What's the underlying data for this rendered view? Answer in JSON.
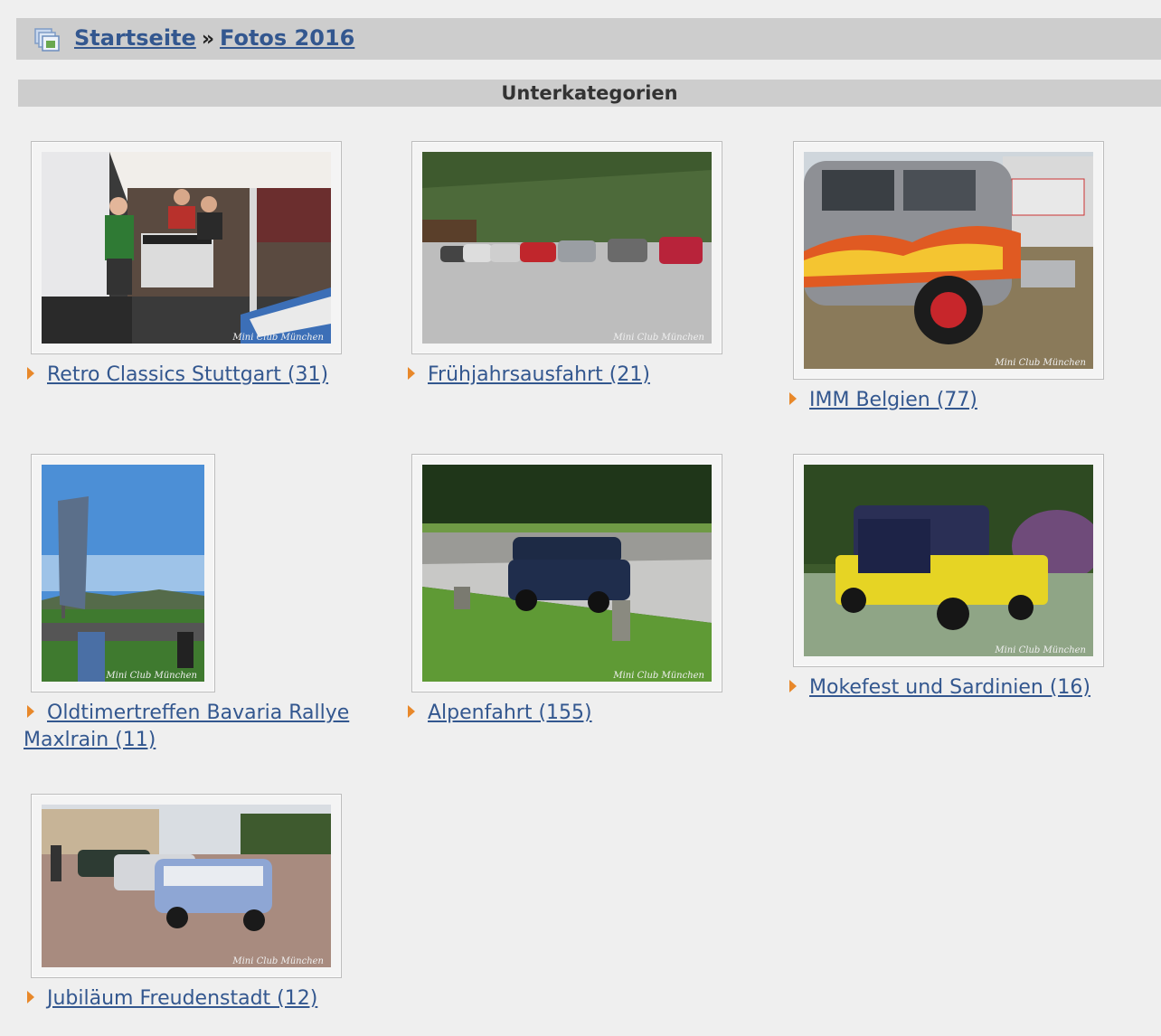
{
  "breadcrumb": {
    "home": "Startseite",
    "separator": "»",
    "current": "Fotos 2016"
  },
  "section": {
    "title": "Unterkategorien"
  },
  "watermark": "Mini Club München",
  "categories": [
    {
      "label": "Retro Classics Stuttgart (31)"
    },
    {
      "label": "Frühjahrsausfahrt (21)"
    },
    {
      "label": "IMM Belgien (77)"
    },
    {
      "label": "Oldtimertreffen Bavaria Rallye Maxlrain (11)"
    },
    {
      "label": "Alpenfahrt (155)"
    },
    {
      "label": "Mokefest und Sardinien (16)"
    },
    {
      "label": "Jubiläum Freudenstadt (12)"
    }
  ],
  "colors": {
    "link": "#33578f",
    "bar": "#cdcdcd",
    "background": "#efefef",
    "bullet": "#e8882a"
  }
}
